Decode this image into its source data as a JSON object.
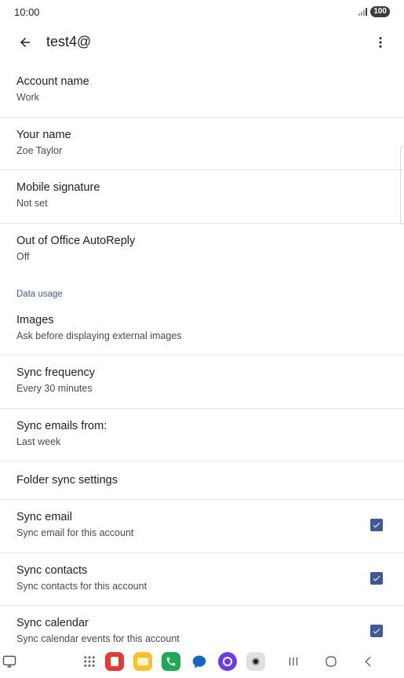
{
  "status": {
    "time": "10:00",
    "battery": "100"
  },
  "header": {
    "title": "test4@"
  },
  "settings": [
    {
      "title": "Account name",
      "value": "Work"
    },
    {
      "title": "Your name",
      "value": "Zoe Taylor"
    },
    {
      "title": "Mobile signature",
      "value": "Not set"
    },
    {
      "title": "Out of Office AutoReply",
      "value": "Off"
    }
  ],
  "data_usage": {
    "header": "Data usage",
    "items": [
      {
        "title": "Images",
        "value": "Ask before displaying external images"
      },
      {
        "title": "Sync frequency",
        "value": "Every 30 minutes"
      },
      {
        "title": "Sync emails from:",
        "value": "Last week"
      }
    ]
  },
  "folder_sync": {
    "title": "Folder sync settings"
  },
  "sync_items": [
    {
      "title": "Sync email",
      "value": "Sync email for this account",
      "checked": true
    },
    {
      "title": "Sync contacts",
      "value": "Sync contacts for this account",
      "checked": true
    },
    {
      "title": "Sync calendar",
      "value": "Sync calendar events for this account",
      "checked": true
    }
  ],
  "colors": {
    "accent": "#3d5a96",
    "section": "#3f5b95"
  },
  "nav": {
    "apps": [
      "apps-grid-icon",
      "office-app-icon",
      "files-app-icon",
      "phone-app-icon",
      "messages-app-icon",
      "browser-app-icon",
      "camera-app-icon"
    ],
    "buttons": [
      "recents-icon",
      "home-icon",
      "back-nav-icon"
    ]
  }
}
